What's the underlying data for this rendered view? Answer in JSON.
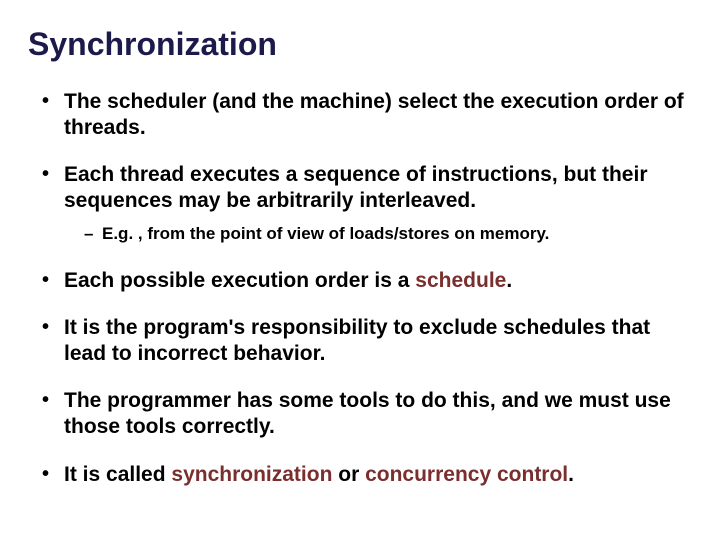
{
  "title": "Synchronization",
  "bullets": {
    "b1": "The scheduler (and the machine) select the execution order of threads.",
    "b2": "Each thread executes a sequence of instructions, but their sequences may be arbitrarily interleaved.",
    "b2_sub": "E.g. , from the point of view of loads/stores on memory.",
    "b3_a": "Each possible execution order is a ",
    "b3_em": "schedule",
    "b3_b": ".",
    "b4": "It is the program's responsibility to exclude schedules that lead to incorrect behavior.",
    "b5": "The programmer has some tools to do this, and we must use those tools correctly.",
    "b6_a": "It is called ",
    "b6_em1": "synchronization",
    "b6_mid": " or ",
    "b6_em2": "concurrency control",
    "b6_b": "."
  }
}
